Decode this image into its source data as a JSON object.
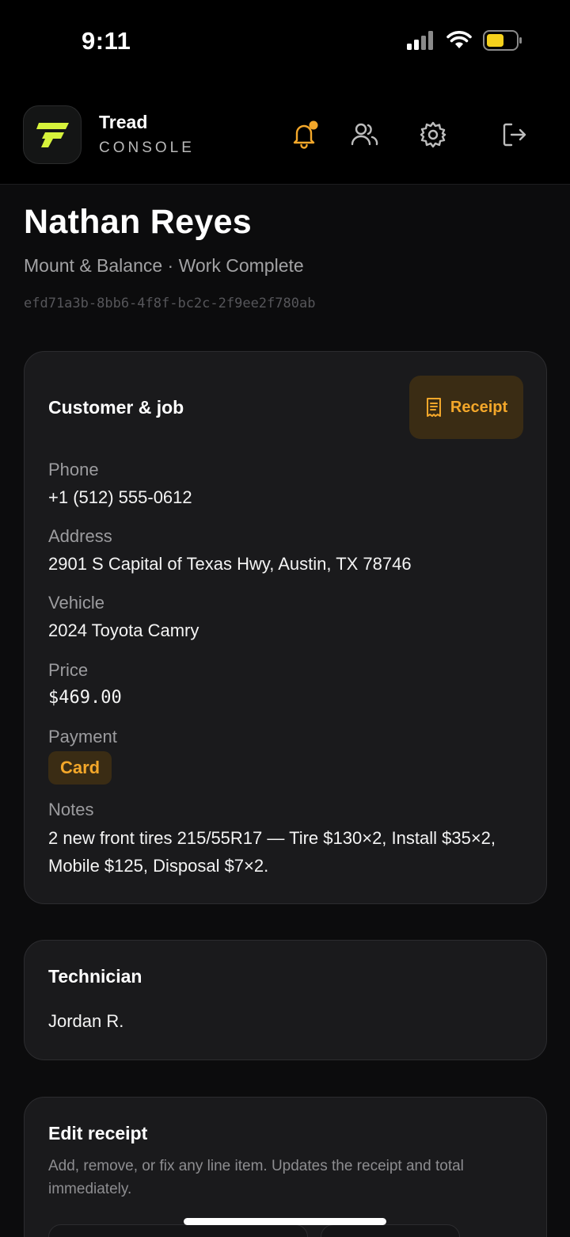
{
  "status_bar": {
    "time": "9:11"
  },
  "header": {
    "brand_name": "Tread",
    "brand_sub": "CONSOLE",
    "icons": [
      "bell-icon",
      "users-icon",
      "gear-icon",
      "logout-icon"
    ],
    "accent": "#f3a72a"
  },
  "job": {
    "customer_name": "Nathan Reyes",
    "status_line": "Mount & Balance · Work Complete",
    "id": "efd71a3b-8bb6-4f8f-bc2c-2f9ee2f780ab"
  },
  "customer_card": {
    "title": "Customer & job",
    "receipt_label": "Receipt",
    "phone_label": "Phone",
    "phone": "+1 (512) 555-0612",
    "address_label": "Address",
    "address": "2901 S Capital of Texas Hwy, Austin, TX 78746",
    "vehicle_label": "Vehicle",
    "vehicle": "2024 Toyota Camry",
    "price_label": "Price",
    "price": "$469.00",
    "payment_label": "Payment",
    "payment": "Card",
    "notes_label": "Notes",
    "notes": "2 new front tires 215/55R17 — Tire $130×2, Install $35×2, Mobile $125, Disposal $7×2."
  },
  "technician_card": {
    "title": "Technician",
    "name": "Jordan R."
  },
  "edit_receipt_card": {
    "title": "Edit receipt",
    "description": "Add, remove, or fix any line item. Updates the receipt and total immediately."
  },
  "colors": {
    "background": "#0c0c0d",
    "card": "#1a1a1c",
    "accent": "#f3a72a",
    "logo": "#d6f23b"
  }
}
